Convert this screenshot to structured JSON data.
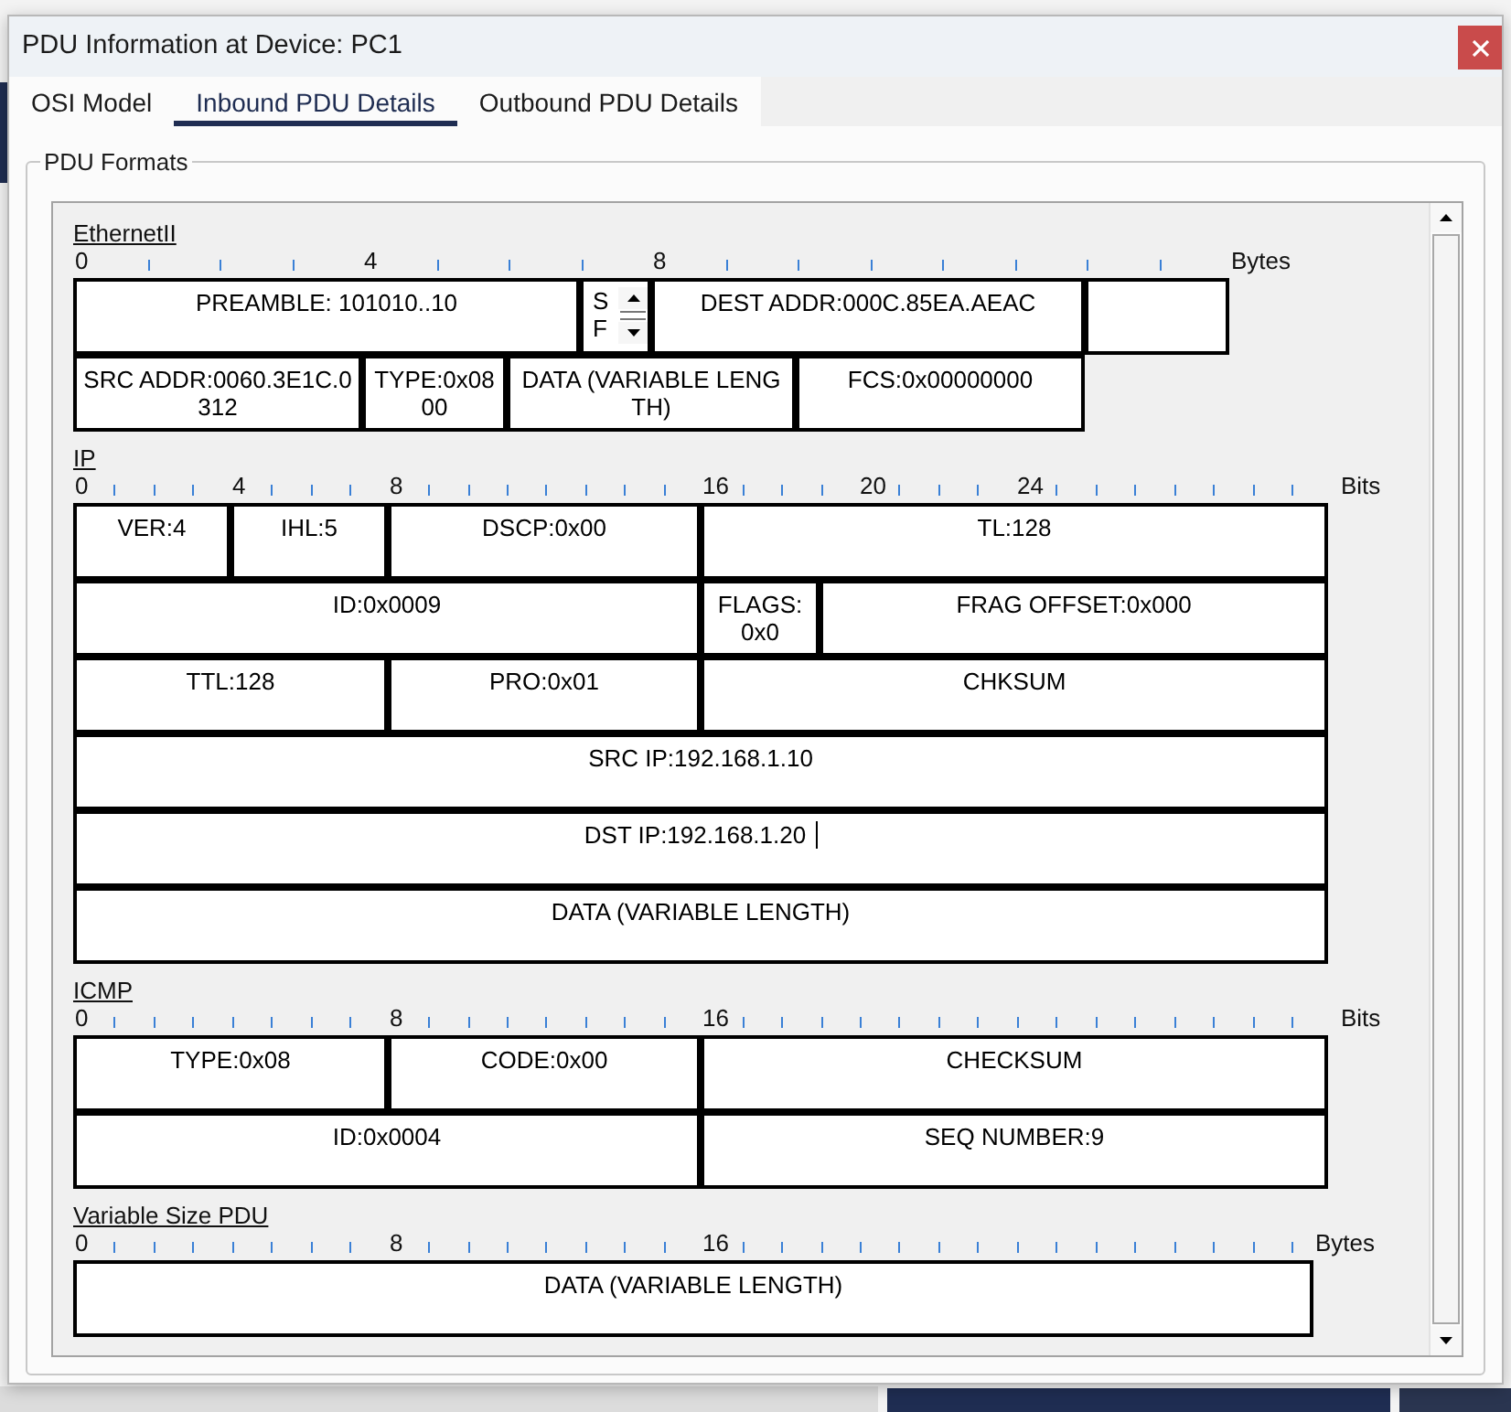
{
  "window": {
    "title": "PDU Information at Device: PC1"
  },
  "tabs": [
    {
      "label": "OSI Model",
      "selected": false
    },
    {
      "label": "Inbound PDU Details",
      "selected": true
    },
    {
      "label": "Outbound PDU Details",
      "selected": false
    }
  ],
  "pdu_formats": {
    "title": "PDU Formats",
    "sections": [
      {
        "title": "EthernetII",
        "ruler": {
          "marks": [
            "0",
            "4",
            "8"
          ],
          "unit": "Bytes"
        },
        "rows": [
          {
            "fields": [
              {
                "kind": "text",
                "text": "PREAMBLE: 101010..10",
                "focused": false
              },
              {
                "kind": "scroll_text",
                "text": "SF",
                "focused": false
              },
              {
                "kind": "text",
                "text": "DEST ADDR:000C.85EA.AEAC",
                "focused": false
              },
              {
                "kind": "blank",
                "focused": false
              }
            ]
          },
          {
            "fields": [
              {
                "kind": "text",
                "text": "SRC ADDR:0060.3E1C.0\n312",
                "focused": false
              },
              {
                "kind": "text",
                "text": "TYPE:0x08\n00",
                "focused": false
              },
              {
                "kind": "text",
                "text": "DATA (VARIABLE LENG\nTH)",
                "focused": false
              },
              {
                "kind": "text",
                "text": "FCS:0x00000000",
                "focused": false
              }
            ]
          }
        ]
      },
      {
        "title": "IP",
        "ruler": {
          "marks": [
            "0",
            "4",
            "8",
            "16",
            "20",
            "24"
          ],
          "unit": "Bits"
        },
        "rows": [
          {
            "fields": [
              {
                "kind": "text",
                "text": "VER:4",
                "focused": false
              },
              {
                "kind": "text",
                "text": "IHL:5",
                "focused": false
              },
              {
                "kind": "text",
                "text": "DSCP:0x00",
                "focused": false
              },
              {
                "kind": "text",
                "text": "TL:128",
                "focused": false
              }
            ]
          },
          {
            "fields": [
              {
                "kind": "text",
                "text": "ID:0x0009",
                "focused": false
              },
              {
                "kind": "text",
                "text": "FLAGS:\n0x0",
                "focused": false
              },
              {
                "kind": "text",
                "text": "FRAG OFFSET:0x000",
                "focused": false
              }
            ]
          },
          {
            "fields": [
              {
                "kind": "text",
                "text": "TTL:128",
                "focused": false
              },
              {
                "kind": "text",
                "text": "PRO:0x01",
                "focused": false
              },
              {
                "kind": "text",
                "text": "CHKSUM",
                "focused": false
              }
            ]
          },
          {
            "fields": [
              {
                "kind": "text",
                "text": "SRC IP:192.168.1.10",
                "focused": false
              }
            ]
          },
          {
            "fields": [
              {
                "kind": "text",
                "text": "DST IP:192.168.1.20",
                "focused": true
              }
            ]
          },
          {
            "fields": [
              {
                "kind": "text",
                "text": "DATA (VARIABLE LENGTH)",
                "focused": false
              }
            ]
          }
        ]
      },
      {
        "title": "ICMP",
        "ruler": {
          "marks": [
            "0",
            "8",
            "16"
          ],
          "unit": "Bits"
        },
        "rows": [
          {
            "fields": [
              {
                "kind": "text",
                "text": "TYPE:0x08",
                "focused": false
              },
              {
                "kind": "text",
                "text": "CODE:0x00",
                "focused": false
              },
              {
                "kind": "text",
                "text": "CHECKSUM",
                "focused": false
              }
            ]
          },
          {
            "fields": [
              {
                "kind": "text",
                "text": "ID:0x0004",
                "focused": false
              },
              {
                "kind": "text",
                "text": "SEQ NUMBER:9",
                "focused": false
              }
            ]
          }
        ]
      },
      {
        "title": "Variable Size PDU",
        "ruler": {
          "marks": [
            "0",
            "8",
            "16"
          ],
          "unit": "Bytes"
        },
        "rows": [
          {
            "fields": [
              {
                "kind": "text",
                "text": "DATA (VARIABLE LENGTH)",
                "focused": false
              }
            ]
          }
        ]
      }
    ]
  }
}
